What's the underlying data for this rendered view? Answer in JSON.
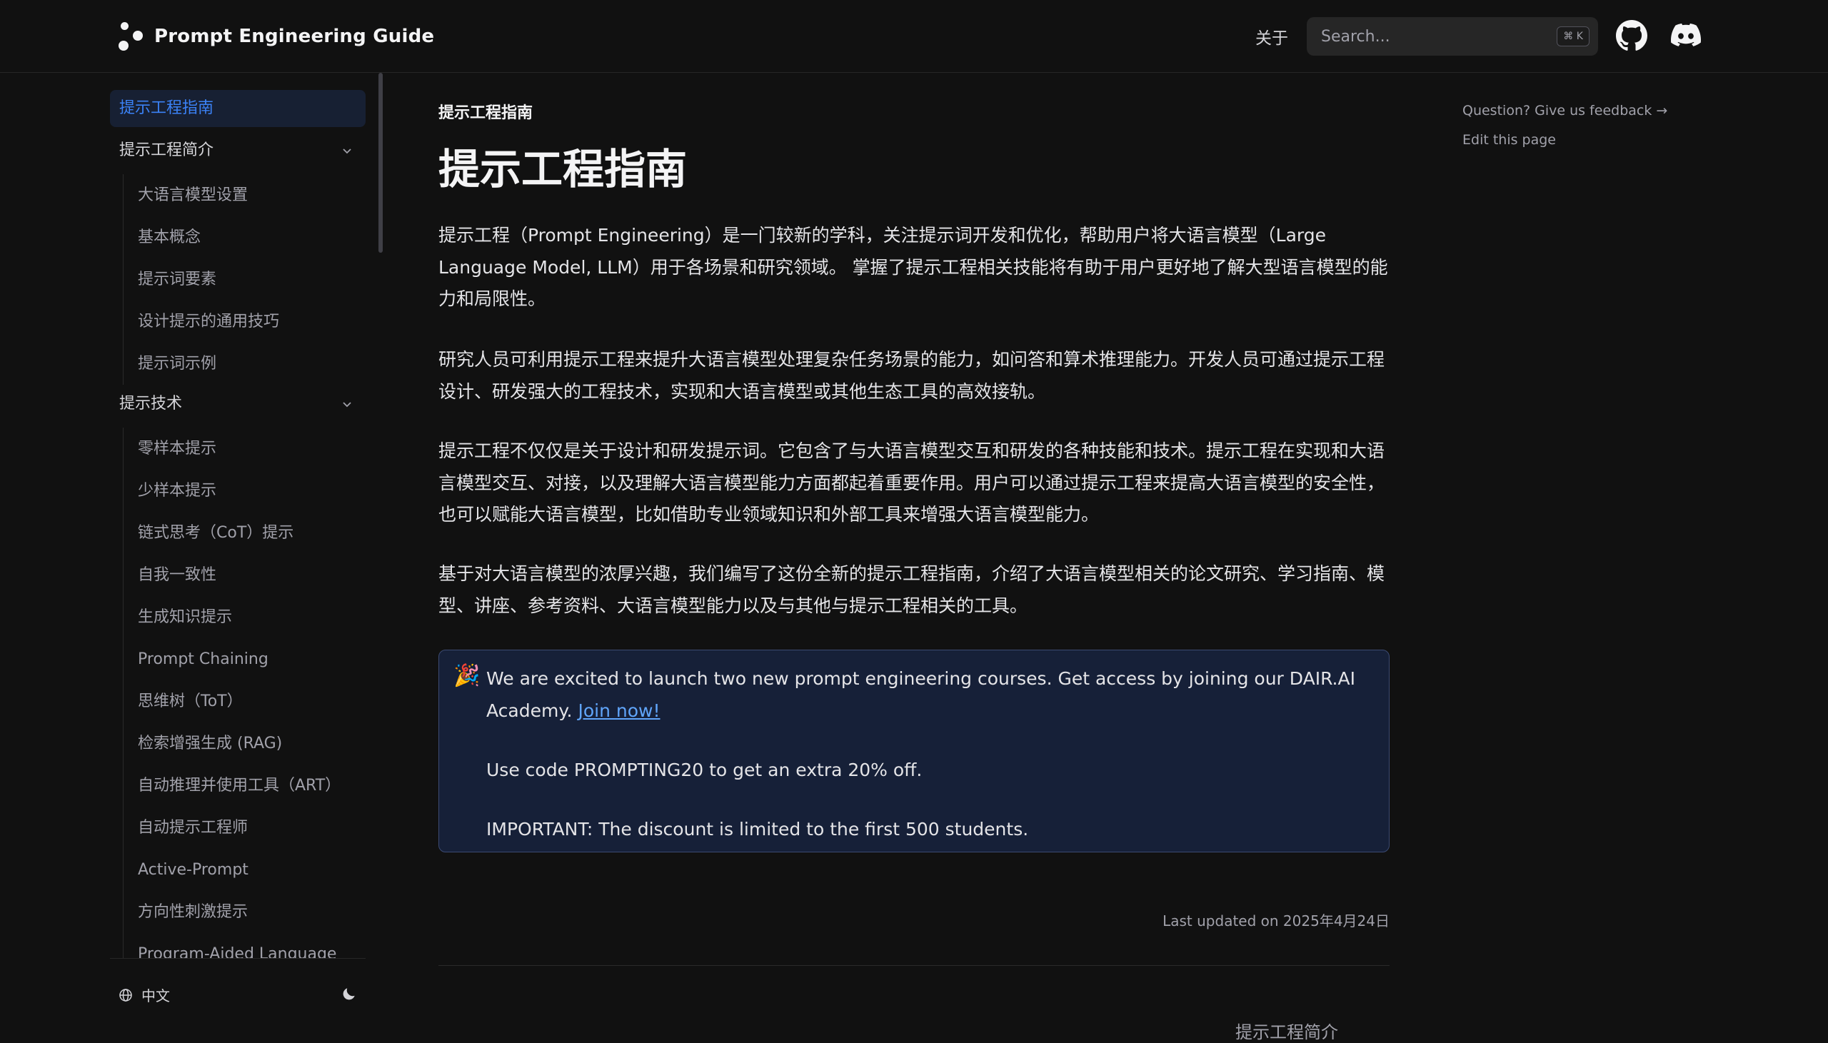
{
  "header": {
    "logo_text": "Prompt Engineering Guide",
    "about_label": "关于",
    "search_placeholder": "Search...",
    "search_shortcut": "⌘ K",
    "github_icon": "github-icon",
    "discord_icon": "discord-icon"
  },
  "sidebar": {
    "active_item": "提示工程指南",
    "groups": [
      {
        "label": "提示工程简介",
        "items": [
          "大语言模型设置",
          "基本概念",
          "提示词要素",
          "设计提示的通用技巧",
          "提示词示例"
        ]
      },
      {
        "label": "提示技术",
        "items": [
          "零样本提示",
          "少样本提示",
          "链式思考（CoT）提示",
          "自我一致性",
          "生成知识提示",
          "Prompt Chaining",
          "思维树（ToT）",
          "检索增强生成 (RAG)",
          "自动推理并使用工具（ART）",
          "自动提示工程师",
          "Active-Prompt",
          "方向性刺激提示",
          "Program-Aided Language"
        ]
      }
    ],
    "footer": {
      "language": "中文",
      "theme_icon": "moon-icon"
    }
  },
  "main": {
    "breadcrumb": "提示工程指南",
    "title": "提示工程指南",
    "paragraphs": [
      "提示工程（Prompt Engineering）是一门较新的学科，关注提示词开发和优化，帮助用户将大语言模型（Large Language Model, LLM）用于各场景和研究领域。 掌握了提示工程相关技能将有助于用户更好地了解大型语言模型的能力和局限性。",
      "研究人员可利用提示工程来提升大语言模型处理复杂任务场景的能力，如问答和算术推理能力。开发人员可通过提示工程设计、研发强大的工程技术，实现和大语言模型或其他生态工具的高效接轨。",
      "提示工程不仅仅是关于设计和研发提示词。它包含了与大语言模型交互和研发的各种技能和技术。提示工程在实现和大语言模型交互、对接，以及理解大语言模型能力方面都起着重要作用。用户可以通过提示工程来提高大语言模型的安全性，也可以赋能大语言模型，比如借助专业领域知识和外部工具来增强大语言模型能力。",
      "基于对大语言模型的浓厚兴趣，我们编写了这份全新的提示工程指南，介绍了大语言模型相关的论文研究、学习指南、模型、讲座、参考资料、大语言模型能力以及与其他与提示工程相关的工具。"
    ],
    "callout": {
      "emoji": "🎉",
      "text": "We are excited to launch two new prompt engineering courses. Get access by joining our DAIR.AI Academy.",
      "link_label": "Join now!",
      "code_line": "Use code PROMPTING20 to get an extra 20% off.",
      "important_line": "IMPORTANT: The discount is limited to the first 500 students."
    },
    "last_updated": "Last updated on 2025年4月24日",
    "next_page_peek": "提示工程简介"
  },
  "toc": {
    "feedback_label": "Question? Give us feedback →",
    "edit_label": "Edit this page"
  },
  "colors": {
    "background": "#111111",
    "accent": "#3b82f6",
    "callout_bg": "#162038",
    "callout_border": "#3b4a72"
  }
}
